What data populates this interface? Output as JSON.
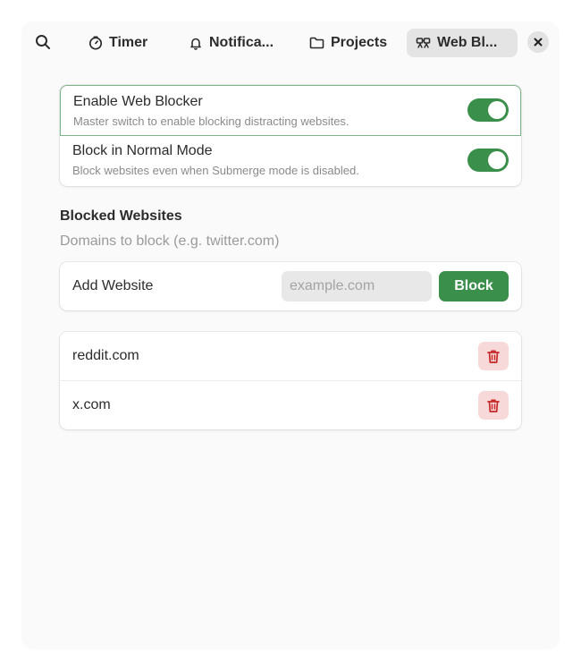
{
  "colors": {
    "accent": "#3a8f4a",
    "danger": "#c62828",
    "danger_bg": "#f8d9d9",
    "active_tab_bg": "#e4e4e4",
    "focus_border": "#7fb38a"
  },
  "header": {
    "search_icon": "search-icon",
    "close_icon": "close-icon",
    "tabs": [
      {
        "label": "Timer",
        "icon": "clock-icon",
        "active": false
      },
      {
        "label": "Notifica...",
        "icon": "bell-icon",
        "active": false
      },
      {
        "label": "Projects",
        "icon": "folder-icon",
        "active": false
      },
      {
        "label": "Web Bl...",
        "icon": "web-blocker-icon",
        "active": true
      }
    ]
  },
  "settings": [
    {
      "title": "Enable Web Blocker",
      "subtitle": "Master switch to enable blocking distracting websites.",
      "enabled": true
    },
    {
      "title": "Block in Normal Mode",
      "subtitle": "Block websites even when Submerge mode is disabled.",
      "enabled": true
    }
  ],
  "blocked": {
    "title": "Blocked Websites",
    "subtitle": "Domains to block (e.g. twitter.com)",
    "add_label": "Add Website",
    "input_value": "",
    "input_placeholder": "example.com",
    "block_button": "Block",
    "sites": [
      {
        "domain": "reddit.com",
        "icon": "trash-icon"
      },
      {
        "domain": "x.com",
        "icon": "trash-icon"
      }
    ]
  }
}
